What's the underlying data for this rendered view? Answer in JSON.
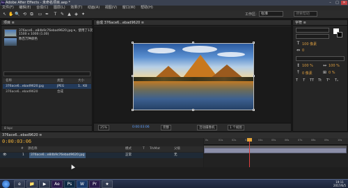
{
  "window": {
    "title": "Adobe After Effects - 未命名项目.aep *",
    "logo": "Ae",
    "minimize": "–",
    "maximize": "□",
    "close": "✕"
  },
  "menu": [
    "文件(F)",
    "编辑(E)",
    "合成(C)",
    "图层(L)",
    "效果(T)",
    "动画(A)",
    "视图(V)",
    "窗口(W)",
    "帮助(H)"
  ],
  "toolbar": {
    "tools": [
      "↖",
      "✋",
      "🔍",
      "⟲",
      "⧉",
      "▭",
      "✒",
      "T",
      "✎",
      "▲",
      "◈",
      "✦"
    ],
    "workspace_label": "工作区:",
    "workspace_value": "标准",
    "search_placeholder": "搜索帮助"
  },
  "project": {
    "tab": "项目 ≡",
    "file_name": "376ace6...e84b9c76ebad9620.jpg ▾，使用了1次",
    "file_dims": "1500 x 1000 (1.00)",
    "file_color": "数百万种颜色",
    "columns": [
      "名称",
      "类型",
      "大小"
    ],
    "rows": [
      {
        "name": "376ace6...ebad9620.jpg",
        "type": "JPEG",
        "size": "1.. KB"
      },
      {
        "name": "376ace6...ebad9620",
        "type": "合成",
        "size": ""
      }
    ],
    "footer": "8 bpc"
  },
  "composition": {
    "tab": "合成 376ace6...ebad9620 ≡",
    "zoom": "25%",
    "timecode": "0:00:03:06",
    "resolution": "完整",
    "camera": "活动摄像机",
    "views": "1 个视图"
  },
  "character": {
    "tab": "字符 ≡",
    "font_size": "100 像素",
    "tracking": "0",
    "scale_v": "100 %",
    "scale_h": "100 %",
    "baseline": "0 像素",
    "tsume": "0 %",
    "styles": [
      "T",
      "T",
      "TT",
      "Tt",
      "T¹",
      "T₁"
    ]
  },
  "timeline": {
    "tab": "376ace6...ebad9620 ≡",
    "timecode": "0:00:03:06",
    "columns": [
      "#",
      "源名称",
      "模式",
      "T",
      "TrkMat",
      "父级"
    ],
    "layer": {
      "index": "1",
      "name": "376ace6...e84b9c76ebad9620.jpg",
      "mode": "正常",
      "parent": "无"
    },
    "ruler_ticks": [
      "0s",
      "01s",
      "02s",
      "03s",
      "04s",
      "05s",
      "06s",
      "07s",
      "08s",
      "09s",
      "10s"
    ]
  },
  "taskbar": {
    "items": [
      "e",
      "📁",
      "▶",
      "Ae",
      "Ps",
      "W",
      "Pr",
      "★"
    ],
    "time": "19:11",
    "date": "2017/6/5"
  }
}
